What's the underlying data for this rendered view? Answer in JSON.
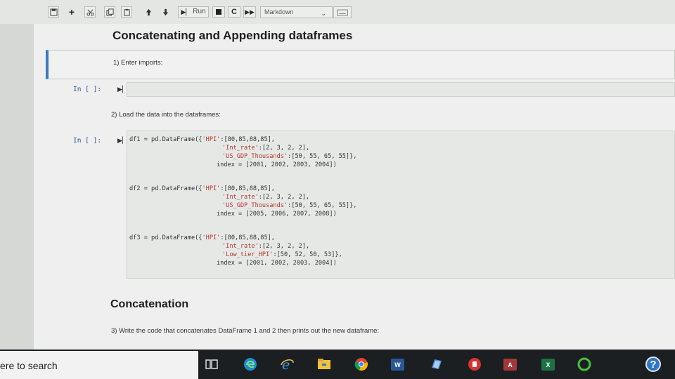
{
  "toolbar": {
    "run_label": "Run",
    "cell_type": "Markdown"
  },
  "notebook": {
    "heading1": "Concatenating and Appending dataframes",
    "step1": "1) Enter imports:",
    "prompt1": "In [ ]:",
    "step2": "2) Load the data into the dataframes:",
    "prompt2": "In [ ]:",
    "code": {
      "df1_l1_a": "df1 = pd.DataFrame({",
      "df1_l1_b": "'HPI'",
      "df1_l1_c": ":[80,85,88,85],",
      "df1_l2_a": "'Int_rate'",
      "df1_l2_b": ":[2, 3, 2, 2],",
      "df1_l3_a": "'US_GDP_Thousands'",
      "df1_l3_b": ":[50, 55, 65, 55]},",
      "df1_l4": "index = [2001, 2002, 2003, 2004])",
      "df2_l1_a": "df2 = pd.DataFrame({",
      "df2_l1_b": "'HPI'",
      "df2_l1_c": ":[80,85,88,85],",
      "df2_l2_a": "'Int_rate'",
      "df2_l2_b": ":[2, 3, 2, 2],",
      "df2_l3_a": "'US_GDP_Thousands'",
      "df2_l3_b": ":[50, 55, 65, 55]},",
      "df2_l4": "index = [2005, 2006, 2007, 2008])",
      "df3_l1_a": "df3 = pd.DataFrame({",
      "df3_l1_b": "'HPI'",
      "df3_l1_c": ":[80,85,88,85],",
      "df3_l2_a": "'Int_rate'",
      "df3_l2_b": ":[2, 3, 2, 2],",
      "df3_l3_a": "'Low_tier_HPI'",
      "df3_l3_b": ":[50, 52, 50, 53]},",
      "df3_l4": "index = [2001, 2002, 2003, 2004])"
    },
    "heading2": "Concatenation",
    "step3": "3) Write the code that concatenates DataFrame 1 and 2 then prints out the new dataframe:"
  },
  "taskbar": {
    "search_text": "ere to search",
    "word_label": "W",
    "access_label": "A",
    "excel_label": "X",
    "help_label": "?"
  },
  "colors": {
    "selected_cell_border": "#3b79c0",
    "prompt": "#3c4fa3",
    "string": "#b8382e",
    "taskbar": "#1c1f22"
  }
}
